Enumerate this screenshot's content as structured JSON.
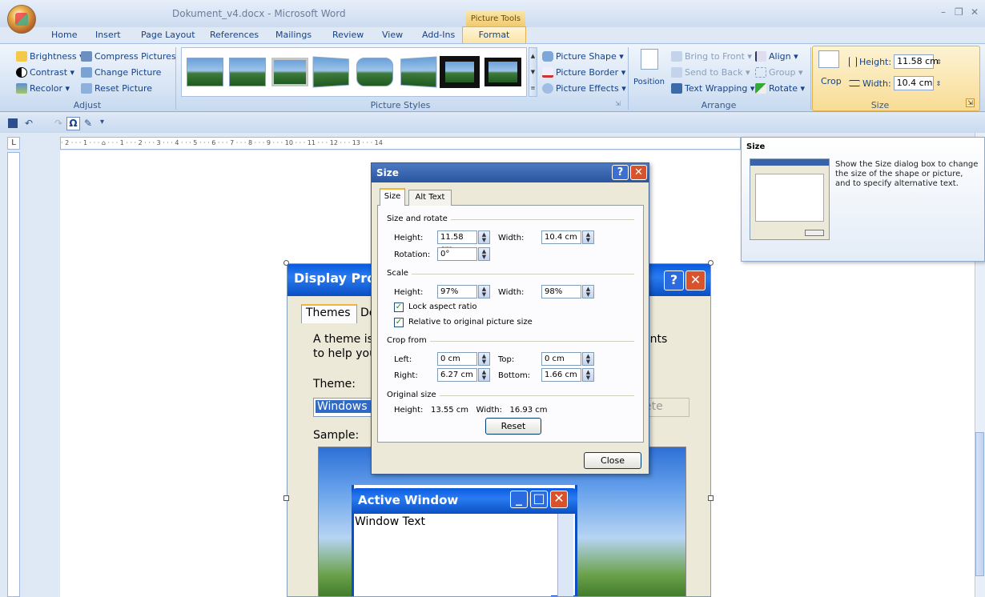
{
  "titlebar": {
    "doc_title": "Dokument_v4.docx - Microsoft Word",
    "context_tab": "Picture Tools",
    "min": "–",
    "restore": "❐",
    "close": "✕"
  },
  "tabs": [
    "Home",
    "Insert",
    "Page Layout",
    "References",
    "Mailings",
    "Review",
    "View",
    "Add-Ins",
    "Format"
  ],
  "ribbon": {
    "adjust": {
      "label": "Adjust",
      "brightness": "Brightness ▾",
      "contrast": "Contrast ▾",
      "recolor": "Recolor ▾",
      "compress": "Compress Pictures",
      "change": "Change Picture",
      "reset": "Reset Picture"
    },
    "styles": {
      "label": "Picture Styles",
      "shape": "Picture Shape ▾",
      "border": "Picture Border ▾",
      "effects": "Picture Effects ▾"
    },
    "arrange": {
      "label": "Arrange",
      "position": "Position",
      "bring_front": "Bring to Front ▾",
      "send_back": "Send to Back ▾",
      "wrapping": "Text Wrapping ▾",
      "align": "Align ▾",
      "group": "Group ▾",
      "rotate": "Rotate ▾"
    },
    "size": {
      "label": "Size",
      "crop": "Crop",
      "height_label": "Height:",
      "height": "11.58 cm",
      "width_label": "Width:",
      "width": "10.4 cm"
    }
  },
  "ruler": {
    "text": "· 2 · · · 1 · · · ⌂ · · · 1 · · · 2 · · · 3 · · · 4 · · · 5 · · · 6 · · · 7 · · · 8 · · · 9 · · · 10 · · · 11 · · · 12 · · · 13 · · · 14",
    "corner": "L"
  },
  "image": {
    "title": "Display Prop",
    "tab1": "Themes",
    "tab2": "De",
    "line1": "A theme is a",
    "line1b": "ents",
    "line2": "to help you",
    "theme_label": "Theme:",
    "theme_value": "Windows >",
    "delete": "ete",
    "sample": "Sample:",
    "active_window": "Active Window",
    "window_text": "Window Text"
  },
  "dialog": {
    "title": "Size",
    "help": "?",
    "close_x": "✕",
    "tab_size": "Size",
    "tab_alt": "Alt Text",
    "size_rotate": "Size and rotate",
    "height_label": "Height:",
    "height": "11.58 cm",
    "width_label": "Width:",
    "width": "10.4 cm",
    "rotation_label": "Rotation:",
    "rotation": "0°",
    "scale": "Scale",
    "scale_height_label": "Height:",
    "scale_height": "97%",
    "scale_width_label": "Width:",
    "scale_width": "98%",
    "lock": "Lock aspect ratio",
    "relative": "Relative to original picture size",
    "crop_from": "Crop from",
    "left_label": "Left:",
    "left": "0 cm",
    "top_label": "Top:",
    "top": "0 cm",
    "right_label": "Right:",
    "right": "6.27 cm",
    "bottom_label": "Bottom:",
    "bottom": "1.66 cm",
    "original": "Original size",
    "orig_line": "Height:   13.55 cm   Width:   16.93 cm",
    "reset": "Reset",
    "close": "Close"
  },
  "tooltip": {
    "title": "Size",
    "body": "Show the Size dialog box to change the size of the shape or picture, and to specify alternative text."
  }
}
